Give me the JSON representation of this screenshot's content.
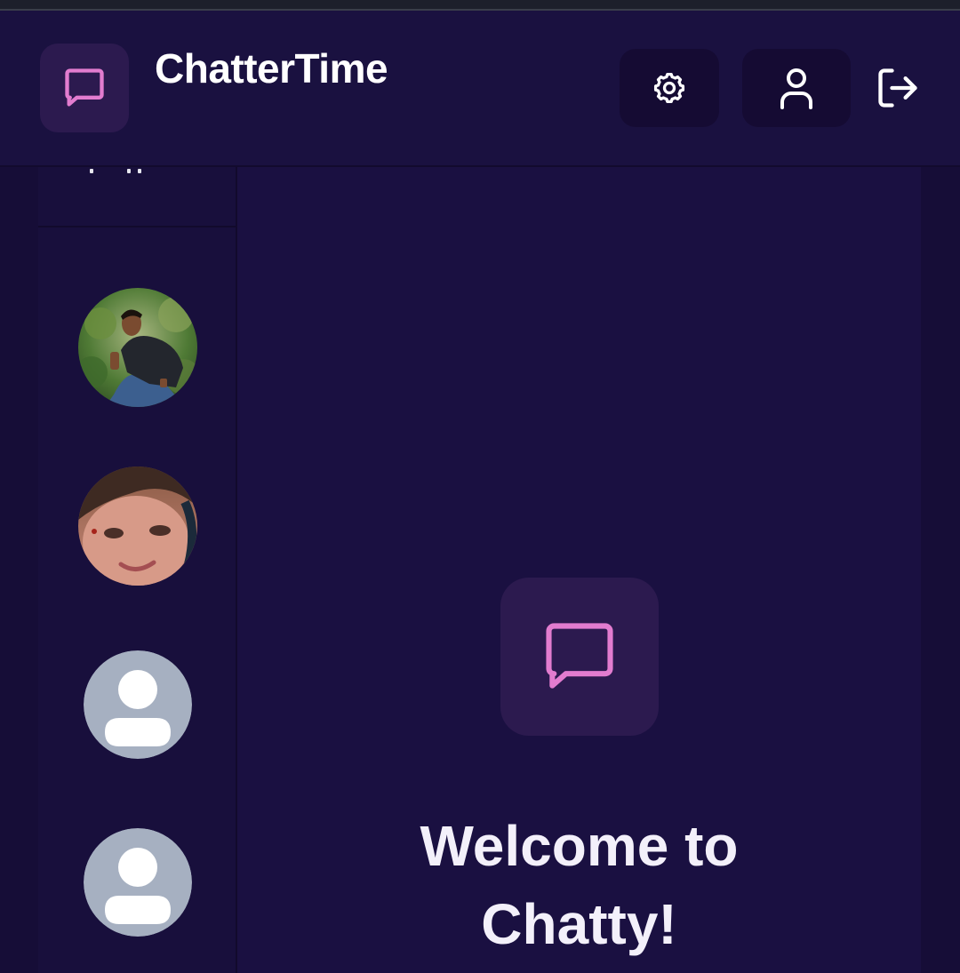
{
  "header": {
    "app_title": "ChatterTime",
    "logo_icon": "chat-bubble-icon",
    "buttons": [
      {
        "name": "settings",
        "icon": "gear-icon"
      },
      {
        "name": "profile",
        "icon": "user-icon"
      },
      {
        "name": "logout",
        "icon": "logout-icon"
      }
    ]
  },
  "sidebar": {
    "contacts": [
      {
        "type": "photo",
        "avatar": "contact-photo-man"
      },
      {
        "type": "photo",
        "avatar": "contact-photo-woman"
      },
      {
        "type": "placeholder",
        "avatar": "default-user-icon"
      },
      {
        "type": "placeholder",
        "avatar": "default-user-icon"
      }
    ]
  },
  "main": {
    "welcome_icon": "chat-bubble-icon",
    "welcome_line1": "Welcome to",
    "welcome_line2": "Chatty!"
  },
  "colors": {
    "background": "#180f3c",
    "header": "#1a1140",
    "accent_pink": "#e27ccf",
    "icon_box": "#2c1a4f",
    "placeholder_avatar": "#a6b0c1"
  }
}
